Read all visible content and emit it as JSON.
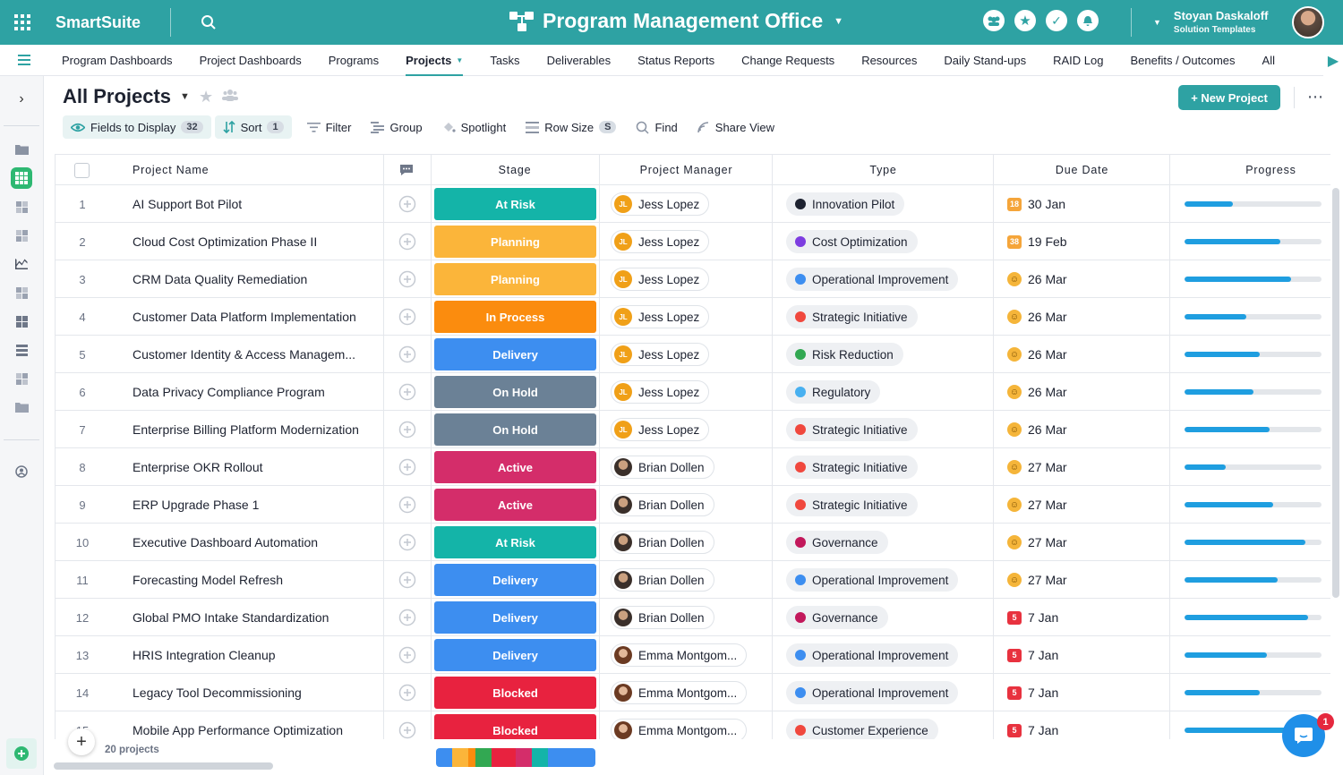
{
  "app": {
    "brand": "SmartSuite",
    "title": "Program Management Office",
    "user_name": "Stoyan Daskaloff",
    "user_org": "Solution Templates"
  },
  "nav": {
    "items": [
      {
        "label": "Program Dashboards"
      },
      {
        "label": "Project Dashboards"
      },
      {
        "label": "Programs"
      },
      {
        "label": "Projects",
        "active": true
      },
      {
        "label": "Tasks"
      },
      {
        "label": "Deliverables"
      },
      {
        "label": "Status Reports"
      },
      {
        "label": "Change Requests"
      },
      {
        "label": "Resources"
      },
      {
        "label": "Daily Stand-ups"
      },
      {
        "label": "RAID Log"
      },
      {
        "label": "Benefits / Outcomes"
      },
      {
        "label": "All"
      }
    ]
  },
  "view": {
    "title": "All Projects",
    "new_button": "+ New Project"
  },
  "toolbar": {
    "fields_label": "Fields to Display",
    "fields_count": "32",
    "sort_label": "Sort",
    "sort_count": "1",
    "filter_label": "Filter",
    "group_label": "Group",
    "spotlight_label": "Spotlight",
    "rowsize_label": "Row Size",
    "rowsize_value": "S",
    "find_label": "Find",
    "share_label": "Share View"
  },
  "columns": {
    "name": "Project Name",
    "stage": "Stage",
    "pm": "Project Manager",
    "type": "Type",
    "due": "Due Date",
    "progress": "Progress"
  },
  "colors": {
    "brand": "#2ea2a3",
    "At Risk": "#14b4a8",
    "Planning": "#fbb53a",
    "In Process": "#fb8c0e",
    "Delivery": "#3d8ef0",
    "On Hold": "#6b8196",
    "Active": "#d42d6a",
    "Blocked": "#e8223f",
    "Innovation Pilot": "#1d2230",
    "Cost Optimization": "#7d3de0",
    "Operational Improvement": "#3d8ef0",
    "Strategic Initiative": "#f0483e",
    "Risk Reduction": "#32a852",
    "Regulatory": "#48b0f0",
    "Governance": "#c2185b",
    "Customer Experience": "#f0483e"
  },
  "rows": [
    {
      "num": "1",
      "name": "AI Support Bot Pilot",
      "stage": "At Risk",
      "pm": "Jess Lopez",
      "pm_initials": "JL",
      "type": "Innovation Pilot",
      "due_badge": "18",
      "due_kind": "badge-orange",
      "due": "30 Jan",
      "progress": 0.35
    },
    {
      "num": "2",
      "name": "Cloud Cost Optimization Phase II",
      "stage": "Planning",
      "pm": "Jess Lopez",
      "pm_initials": "JL",
      "type": "Cost Optimization",
      "due_badge": "38",
      "due_kind": "badge-orange",
      "due": "19 Feb",
      "progress": 0.7
    },
    {
      "num": "3",
      "name": "CRM Data Quality Remediation",
      "stage": "Planning",
      "pm": "Jess Lopez",
      "pm_initials": "JL",
      "type": "Operational Improvement",
      "due_badge": "",
      "due_kind": "smile",
      "due": "26 Mar",
      "progress": 0.78
    },
    {
      "num": "4",
      "name": "Customer Data Platform Implementation",
      "stage": "In Process",
      "pm": "Jess Lopez",
      "pm_initials": "JL",
      "type": "Strategic Initiative",
      "due_badge": "",
      "due_kind": "smile",
      "due": "26 Mar",
      "progress": 0.45
    },
    {
      "num": "5",
      "name": "Customer Identity & Access Managem...",
      "stage": "Delivery",
      "pm": "Jess Lopez",
      "pm_initials": "JL",
      "type": "Risk Reduction",
      "due_badge": "",
      "due_kind": "smile",
      "due": "26 Mar",
      "progress": 0.55
    },
    {
      "num": "6",
      "name": "Data Privacy Compliance Program",
      "stage": "On Hold",
      "pm": "Jess Lopez",
      "pm_initials": "JL",
      "type": "Regulatory",
      "due_badge": "",
      "due_kind": "smile",
      "due": "26 Mar",
      "progress": 0.5
    },
    {
      "num": "7",
      "name": "Enterprise Billing Platform Modernization",
      "stage": "On Hold",
      "pm": "Jess Lopez",
      "pm_initials": "JL",
      "type": "Strategic Initiative",
      "due_badge": "",
      "due_kind": "smile",
      "due": "26 Mar",
      "progress": 0.62
    },
    {
      "num": "8",
      "name": "Enterprise OKR Rollout",
      "stage": "Active",
      "pm": "Brian Dollen",
      "pm_initials": "",
      "type": "Strategic Initiative",
      "due_badge": "",
      "due_kind": "smile",
      "due": "27 Mar",
      "progress": 0.3
    },
    {
      "num": "9",
      "name": "ERP Upgrade Phase 1",
      "stage": "Active",
      "pm": "Brian Dollen",
      "pm_initials": "",
      "type": "Strategic Initiative",
      "due_badge": "",
      "due_kind": "smile",
      "due": "27 Mar",
      "progress": 0.65
    },
    {
      "num": "10",
      "name": "Executive Dashboard Automation",
      "stage": "At Risk",
      "pm": "Brian Dollen",
      "pm_initials": "",
      "type": "Governance",
      "due_badge": "",
      "due_kind": "smile",
      "due": "27 Mar",
      "progress": 0.88
    },
    {
      "num": "11",
      "name": "Forecasting Model Refresh",
      "stage": "Delivery",
      "pm": "Brian Dollen",
      "pm_initials": "",
      "type": "Operational Improvement",
      "due_badge": "",
      "due_kind": "smile",
      "due": "27 Mar",
      "progress": 0.68
    },
    {
      "num": "12",
      "name": "Global PMO Intake Standardization",
      "stage": "Delivery",
      "pm": "Brian Dollen",
      "pm_initials": "",
      "type": "Governance",
      "due_badge": "5",
      "due_kind": "badge-red",
      "due": "7 Jan",
      "progress": 0.9
    },
    {
      "num": "13",
      "name": "HRIS Integration Cleanup",
      "stage": "Delivery",
      "pm": "Emma Montgom...",
      "pm_initials": "",
      "type": "Operational Improvement",
      "due_badge": "5",
      "due_kind": "badge-red",
      "due": "7 Jan",
      "progress": 0.6
    },
    {
      "num": "14",
      "name": "Legacy Tool Decommissioning",
      "stage": "Blocked",
      "pm": "Emma Montgom...",
      "pm_initials": "",
      "type": "Operational Improvement",
      "due_badge": "5",
      "due_kind": "badge-red",
      "due": "7 Jan",
      "progress": 0.55
    },
    {
      "num": "15",
      "name": "Mobile App Performance Optimization",
      "stage": "Blocked",
      "pm": "Emma Montgom...",
      "pm_initials": "",
      "type": "Customer Experience",
      "due_badge": "5",
      "due_kind": "badge-red",
      "due": "7 Jan",
      "progress": 0.75
    }
  ],
  "footer": {
    "count": "20 projects",
    "stage_summary": [
      {
        "stage": "Delivery",
        "share": 0.1
      },
      {
        "stage": "Planning",
        "share": 0.1
      },
      {
        "stage": "In Process",
        "share": 0.05
      },
      {
        "stage": "Risk Reduction",
        "share": 0.1
      },
      {
        "stage": "Blocked",
        "share": 0.15
      },
      {
        "stage": "Active",
        "share": 0.1
      },
      {
        "stage": "At Risk",
        "share": 0.1
      },
      {
        "stage": "Operational Improvement",
        "share": 0.3
      }
    ],
    "chat_badge": "1"
  }
}
